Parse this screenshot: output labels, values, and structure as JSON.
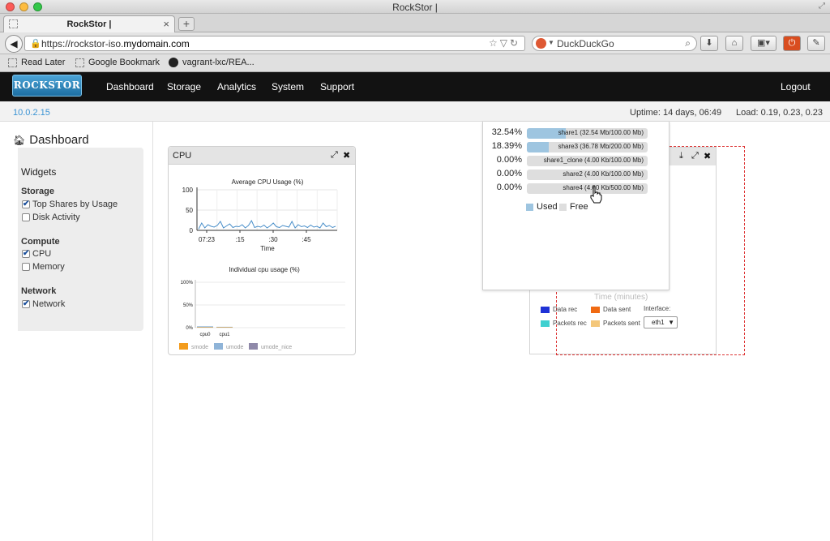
{
  "browser": {
    "window_title": "RockStor |",
    "tab_title": "RockStor |",
    "new_tab": "+",
    "url_prefix": "https://rockstor-iso.",
    "url_domain": "mydomain.com",
    "search_placeholder": "DuckDuckGo",
    "bookmarks": [
      "Read Later",
      "Google Bookmark",
      "vagrant-lxc/REA..."
    ]
  },
  "app": {
    "logo": "ROCKSTOR",
    "nav": [
      "Dashboard",
      "Storage",
      "Analytics",
      "System",
      "Support"
    ],
    "logout": "Logout",
    "ip": "10.0.2.15",
    "uptime": "Uptime: 14 days, 06:49",
    "load": "Load: 0.19, 0.23, 0.23",
    "colors": {
      "accent": "#3a93d4",
      "nav_bg": "#121212"
    }
  },
  "sidebar": {
    "title": "Dashboard",
    "widgets_heading": "Widgets",
    "groups": [
      {
        "name": "Storage",
        "items": [
          {
            "label": "Top Shares by Usage",
            "checked": true
          },
          {
            "label": "Disk Activity",
            "checked": false
          }
        ]
      },
      {
        "name": "Compute",
        "items": [
          {
            "label": "CPU",
            "checked": true
          },
          {
            "label": "Memory",
            "checked": false
          }
        ]
      },
      {
        "name": "Network",
        "items": [
          {
            "label": "Network",
            "checked": true
          }
        ]
      }
    ]
  },
  "cpu_widget": {
    "title": "CPU",
    "chart_data": [
      {
        "type": "line",
        "title": "Average CPU Usage (%)",
        "xlabel": "Time",
        "ylabel": "",
        "ylim": [
          0,
          100
        ],
        "yticks": [
          0,
          50,
          100
        ],
        "xticks": [
          "07:23",
          ":15",
          ":30",
          ":45"
        ],
        "series": [
          {
            "values": [
              3,
              18,
              6,
              14,
              10,
              8,
              12,
              22,
              6,
              11,
              16,
              7,
              10,
              9,
              14,
              6,
              12,
              24,
              7,
              10,
              8,
              13,
              6,
              11,
              18,
              9,
              7,
              12,
              10,
              8,
              22,
              6,
              14,
              9,
              11,
              7,
              13,
              8,
              10,
              6,
              18,
              9,
              12,
              7,
              10
            ]
          }
        ]
      },
      {
        "type": "bar",
        "title": "Individual cpu usage (%)",
        "categories": [
          "cpu0",
          "cpu1"
        ],
        "yticks": [
          "0%",
          "50%",
          "100%"
        ],
        "ylim": [
          0,
          100
        ],
        "series": [
          {
            "name": "smode",
            "color": "#f39c1d",
            "values": [
              1,
              1
            ]
          },
          {
            "name": "umode",
            "color": "#8fb4d8",
            "values": [
              2,
              1
            ]
          },
          {
            "name": "umode_nice",
            "color": "#8f89a9",
            "values": [
              0,
              0
            ]
          }
        ]
      }
    ]
  },
  "shares_widget": {
    "chart_data": {
      "type": "bar",
      "title": "",
      "categories": [
        "share1",
        "share3",
        "share1_clone",
        "share2",
        "share4"
      ],
      "rows": [
        {
          "pct": "32.54%",
          "label": "share1 (32.54 Mb/100.00 Mb)",
          "used": 32.54
        },
        {
          "pct": "18.39%",
          "label": "share3 (36.78 Mb/200.00 Mb)",
          "used": 18.39
        },
        {
          "pct": "0.00%",
          "label": "share1_clone (4.00 Kb/100.00 Mb)",
          "used": 0
        },
        {
          "pct": "0.00%",
          "label": "share2 (4.00 Kb/100.00 Mb)",
          "used": 0
        },
        {
          "pct": "0.00%",
          "label": "share4 (4.00 Kb/500.00 Mb)",
          "used": 0
        }
      ],
      "legend": [
        {
          "name": "Used",
          "color": "#9ec5e0"
        },
        {
          "name": "Free",
          "color": "#dedede"
        }
      ]
    }
  },
  "network_widget": {
    "xlabel": "Time (minutes)",
    "legend": [
      {
        "name": "Data rec",
        "color": "#1f32d6"
      },
      {
        "name": "Data sent",
        "color": "#f06a12"
      },
      {
        "name": "Packets rec",
        "color": "#3fd0d0"
      },
      {
        "name": "Packets sent",
        "color": "#f4c77a"
      }
    ],
    "interface_label": "Interface:",
    "interface_value": "eth1"
  }
}
